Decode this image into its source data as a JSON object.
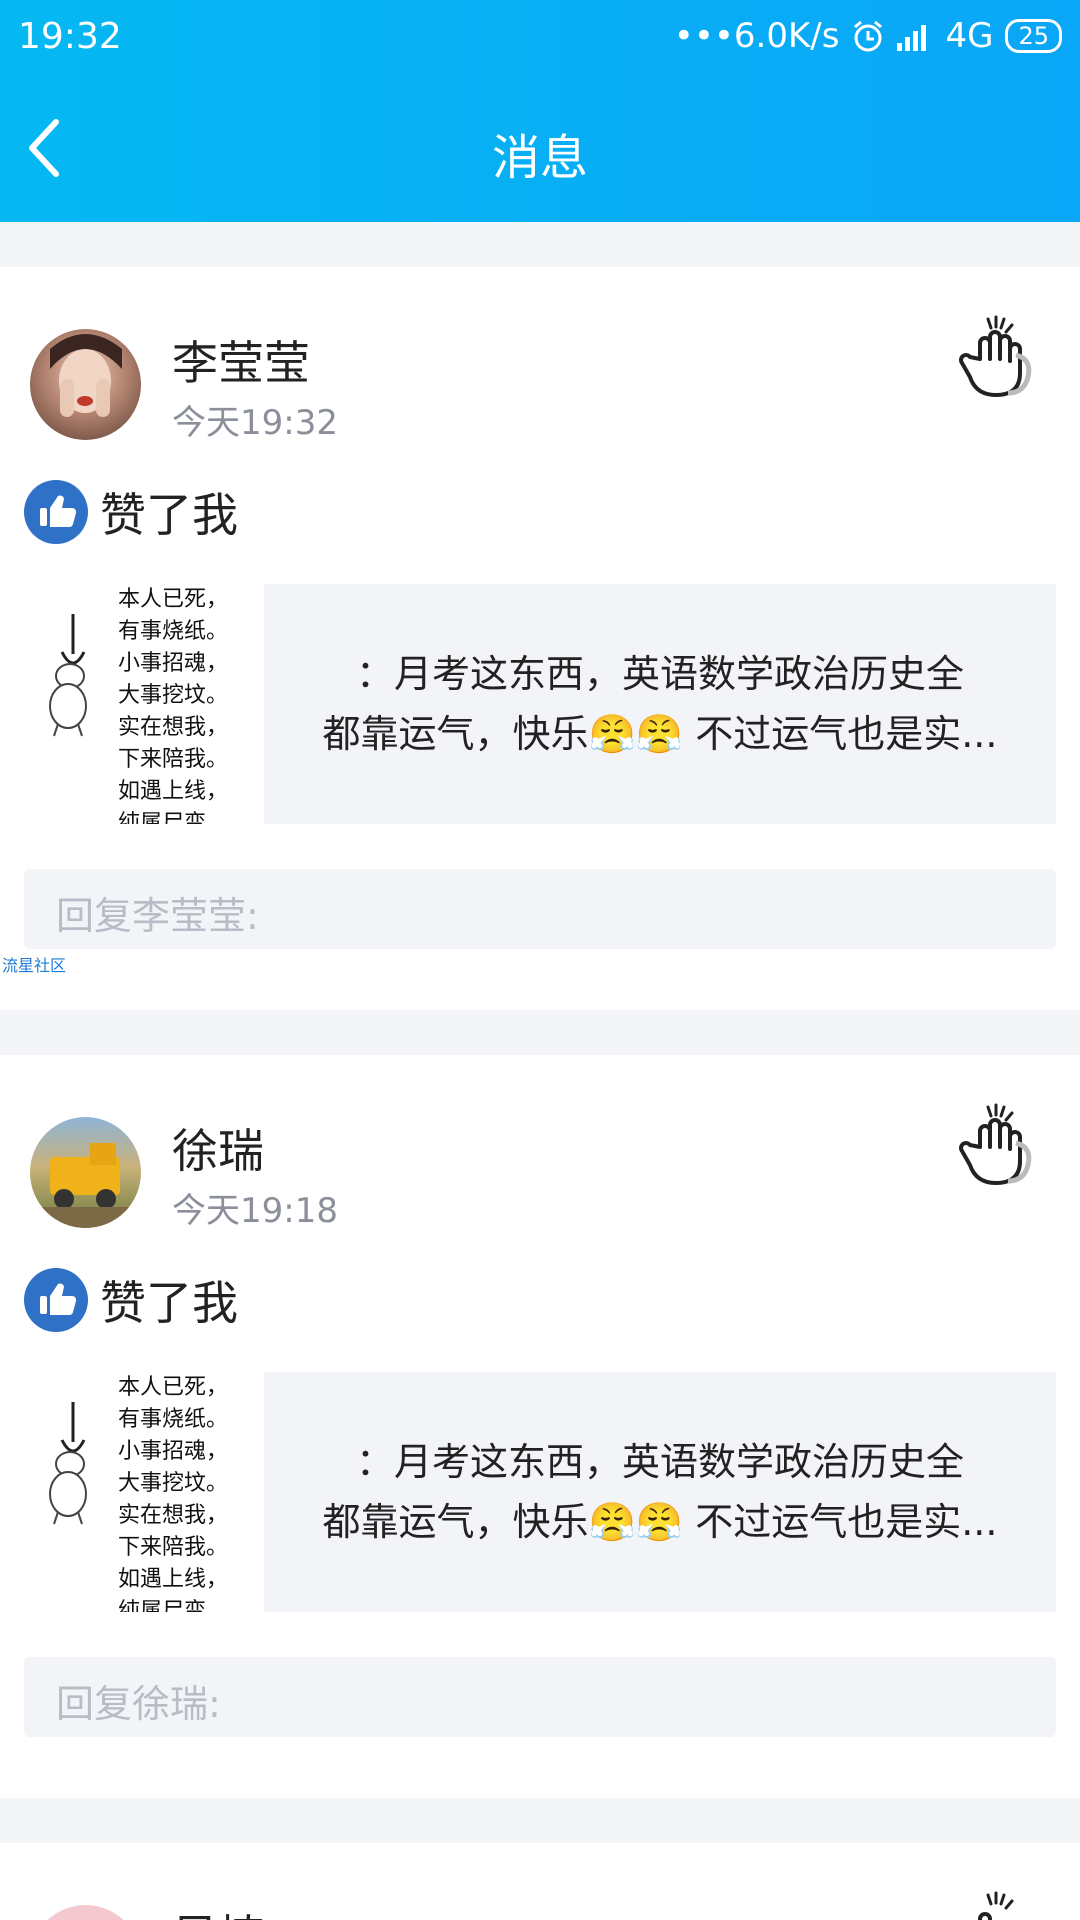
{
  "status": {
    "time": "19:32",
    "net_speed": "•••6.0K/s",
    "network": "4G",
    "battery": "25"
  },
  "header": {
    "title": "消息"
  },
  "watermark": "流星社区",
  "messages": [
    {
      "name": "李莹莹",
      "time": "今天19:32",
      "action": "赞了我",
      "thumb_lines": [
        "本人已死，",
        "有事烧纸。",
        "小事招魂，",
        "大事挖坟。",
        "实在想我，",
        "下来陪我。",
        "如遇上线，",
        "纯属尸变。"
      ],
      "quote_line1": "：月考这东西，英语数学政治历史全",
      "quote_line2": "都靠运气，快乐😤😤 不过运气也是实...",
      "reply_placeholder": "回复李莹莹:"
    },
    {
      "name": "徐瑞",
      "time": "今天19:18",
      "action": "赞了我",
      "thumb_lines": [
        "本人已死，",
        "有事烧纸。",
        "小事招魂，",
        "大事挖坟。",
        "实在想我，",
        "下来陪我。",
        "如遇上线，",
        "纯属尸变。"
      ],
      "quote_line1": "：月考这东西，英语数学政治历史全",
      "quote_line2": "都靠运气，快乐😤😤 不过运气也是实...",
      "reply_placeholder": "回复徐瑞:"
    },
    {
      "name": "吴楠"
    }
  ]
}
